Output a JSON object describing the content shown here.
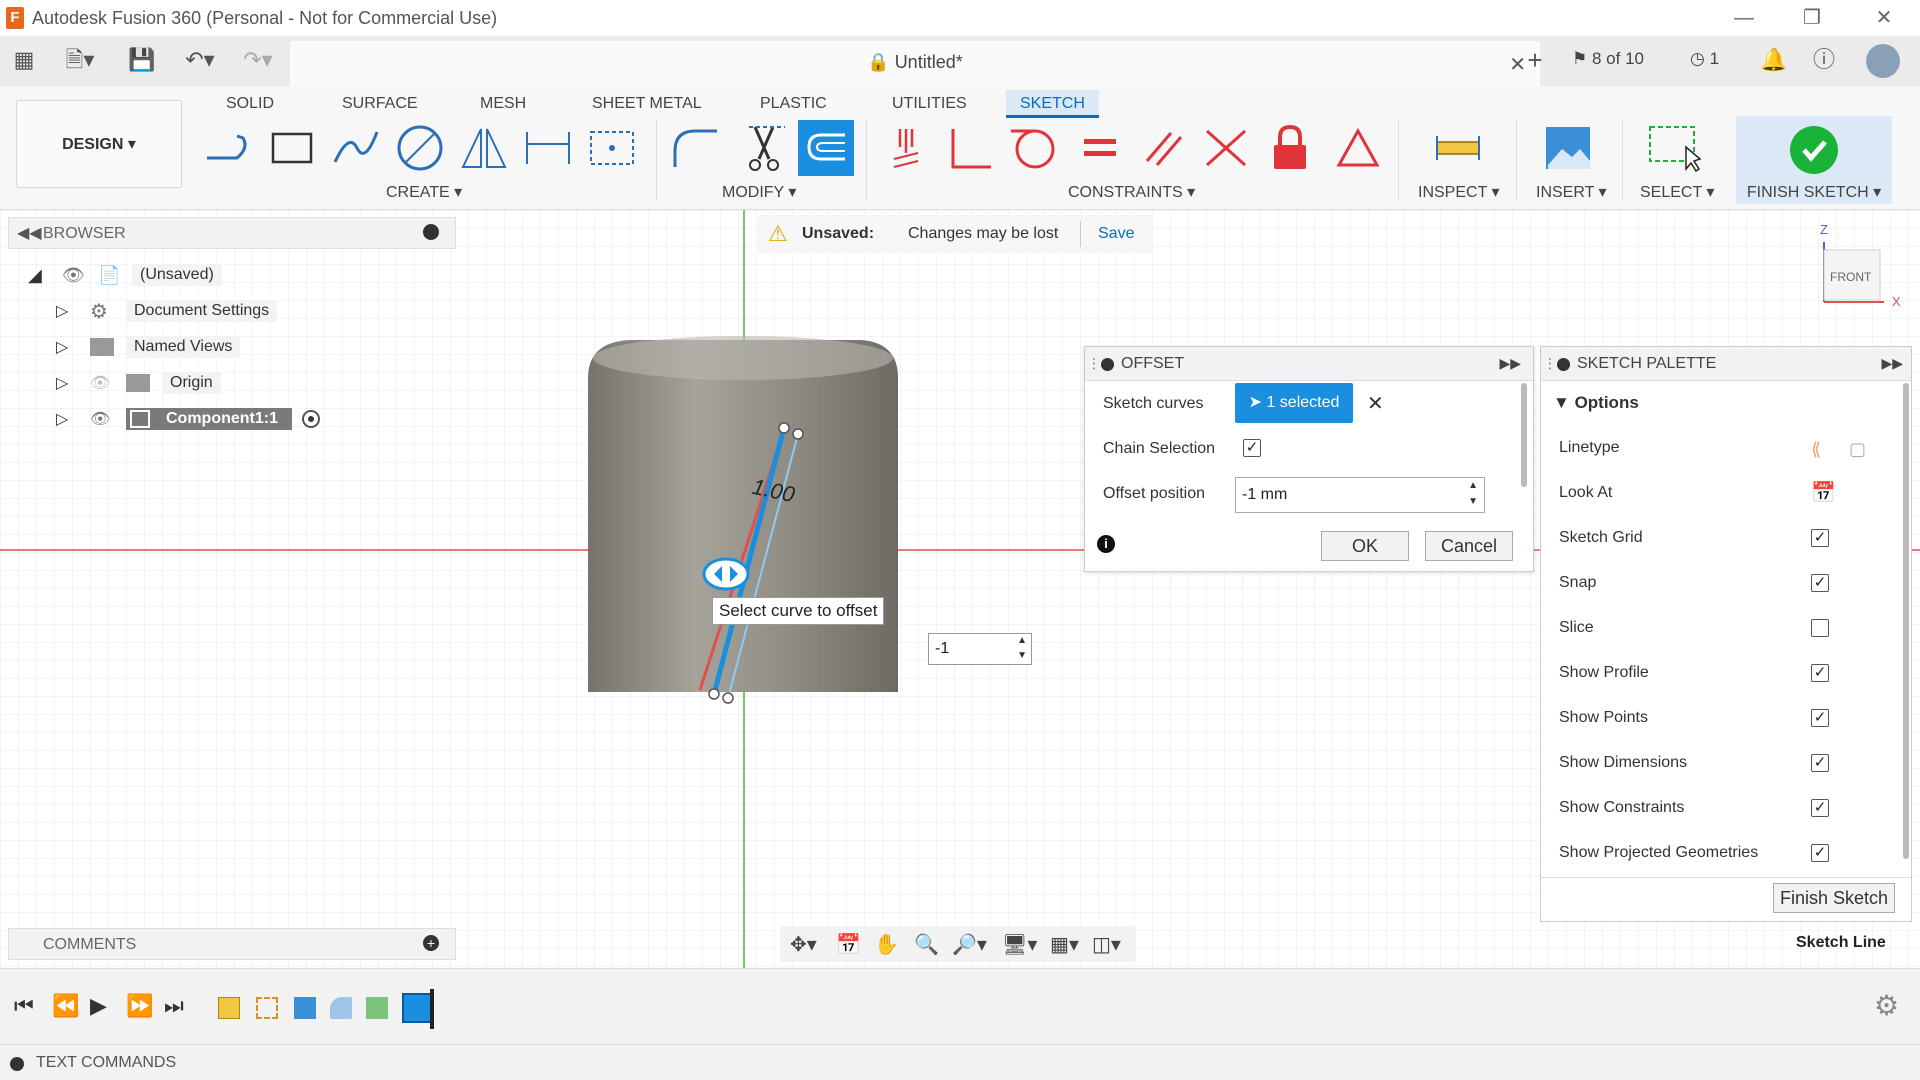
{
  "titlebar": {
    "title": "Autodesk Fusion 360 (Personal - Not for Commercial Use)"
  },
  "document": {
    "tab_title": "Untitled*",
    "job_status": "8 of 10",
    "clock_count": "1"
  },
  "ribbon": {
    "tabs": [
      "SOLID",
      "SURFACE",
      "MESH",
      "SHEET METAL",
      "PLASTIC",
      "UTILITIES",
      "SKETCH"
    ],
    "active_tab": "SKETCH",
    "workspace": "DESIGN",
    "groups": {
      "create": "CREATE",
      "modify": "MODIFY",
      "constraints": "CONSTRAINTS",
      "inspect": "INSPECT",
      "insert": "INSERT",
      "select": "SELECT",
      "finish_sketch": "FINISH SKETCH"
    }
  },
  "browser": {
    "header": "BROWSER",
    "items": [
      {
        "label": "(Unsaved)"
      },
      {
        "label": "Document Settings"
      },
      {
        "label": "Named Views"
      },
      {
        "label": "Origin"
      },
      {
        "label": "Component1:1"
      }
    ]
  },
  "banner": {
    "title": "Unsaved:",
    "message": "Changes may be lost",
    "action": "Save"
  },
  "offset_dialog": {
    "title": "OFFSET",
    "sketch_curves_label": "Sketch curves",
    "selection": "1 selected",
    "chain_selection_label": "Chain Selection",
    "chain_selection_checked": true,
    "offset_position_label": "Offset position",
    "offset_position_value": "-1 mm",
    "ok": "OK",
    "cancel": "Cancel"
  },
  "sketch_palette": {
    "title": "SKETCH PALETTE",
    "section": "Options",
    "rows": [
      {
        "label": "Linetype",
        "kind": "icons"
      },
      {
        "label": "Look At",
        "kind": "icon"
      },
      {
        "label": "Sketch Grid",
        "checked": true
      },
      {
        "label": "Snap",
        "checked": true
      },
      {
        "label": "Slice",
        "checked": false
      },
      {
        "label": "Show Profile",
        "checked": true
      },
      {
        "label": "Show Points",
        "checked": true
      },
      {
        "label": "Show Dimensions",
        "checked": true
      },
      {
        "label": "Show Constraints",
        "checked": true
      },
      {
        "label": "Show Projected Geometries",
        "checked": true
      }
    ],
    "finish_button": "Finish Sketch"
  },
  "viewport": {
    "tooltip": "Select curve to offset",
    "inline_value": "-1",
    "dimension_label": "1.00",
    "viewcube_face": "FRONT",
    "axis_z": "Z",
    "axis_x": "X"
  },
  "comments": {
    "header": "COMMENTS"
  },
  "status": {
    "sketch_line": "Sketch Line"
  },
  "text_commands": {
    "label": "TEXT COMMANDS"
  },
  "colors": {
    "accent": "#1a8fdf",
    "finish_green": "#1ab33a",
    "constraint_red": "#e0343b"
  }
}
